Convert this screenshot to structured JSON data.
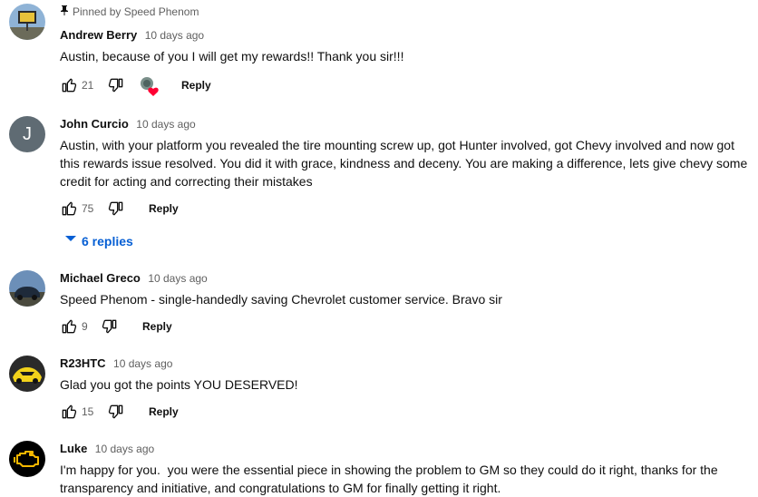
{
  "pinned": {
    "text": "Pinned by Speed Phenom",
    "icon": "pin-icon"
  },
  "ui": {
    "reply_label": "Reply"
  },
  "comments": [
    {
      "author": "Andrew Berry",
      "time": "10 days ago",
      "text": "Austin, because of you I will get my rewards!! Thank you sir!!!",
      "likes": "21",
      "hearted": true,
      "avatar": "photo-sign"
    },
    {
      "author": "John Curcio",
      "time": "10 days ago",
      "text": "Austin, with your platform you revealed the tire mounting screw up, got Hunter involved, got Chevy involved and now got this rewards issue resolved. You did it with grace, kindness and deceny. You are making a difference, lets give chevy some credit for acting and correcting their mistakes",
      "likes": "75",
      "avatar_letter": "J",
      "avatar_color": "#5f6b73",
      "replies_label": "6 replies"
    },
    {
      "author": "Michael Greco",
      "time": "10 days ago",
      "text": "Speed Phenom - single-handedly saving Chevrolet customer service. Bravo sir",
      "likes": "9",
      "avatar": "photo-car"
    },
    {
      "author": "R23HTC",
      "time": "10 days ago",
      "text": "Glad you got the points YOU DESERVED!",
      "likes": "15",
      "avatar": "photo-yellow-corvette"
    },
    {
      "author": "Luke",
      "time": "10 days ago",
      "text": "I'm happy for you.  you were the essential piece in showing the problem to GM so they could do it right, thanks for the transparency and initiative, and congratulations to GM for finally getting it right.",
      "avatar": "check-engine-icon"
    }
  ],
  "colors": {
    "link": "#065fd4",
    "meta": "#606060",
    "heart": "#ff0033"
  }
}
